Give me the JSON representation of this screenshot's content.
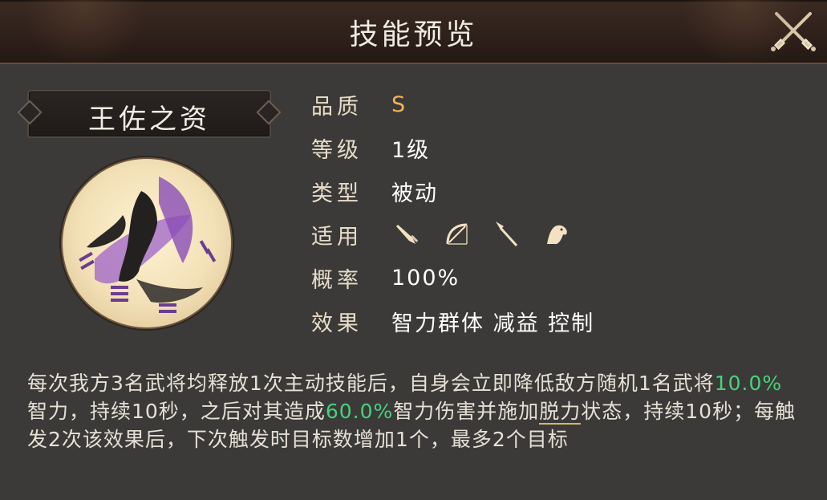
{
  "header": {
    "title": "技能预览"
  },
  "skill": {
    "name": "王佐之资",
    "rows": {
      "quality": {
        "label": "品质",
        "value": "S"
      },
      "level": {
        "label": "等级",
        "value": "1级"
      },
      "type": {
        "label": "类型",
        "value": "被动"
      },
      "applicable": {
        "label": "适用",
        "icons": [
          "sword-icon",
          "bow-icon",
          "spear-icon",
          "horse-icon"
        ]
      },
      "chance": {
        "label": "概率",
        "value": "100%"
      },
      "effect": {
        "label": "效果",
        "value": "智力群体 减益 控制"
      }
    }
  },
  "description": {
    "p1": "每次我方3名武将均释放1次主动技能后，自身会立即降低敌方随机1名武将",
    "v1": "10.0%",
    "p2": "智力，持续10秒，之后对其造成",
    "v2": "60.0%",
    "p3": "智力伤害并施加",
    "status": "脱力",
    "p4": "状态，持续10秒；每触发2次该效果后，下次触发时目标数增加1个，最多2个目标"
  },
  "colors": {
    "accent_gold": "#f3b35c",
    "highlight_green": "#47d27c",
    "panel_bg": "#3b3a38"
  }
}
